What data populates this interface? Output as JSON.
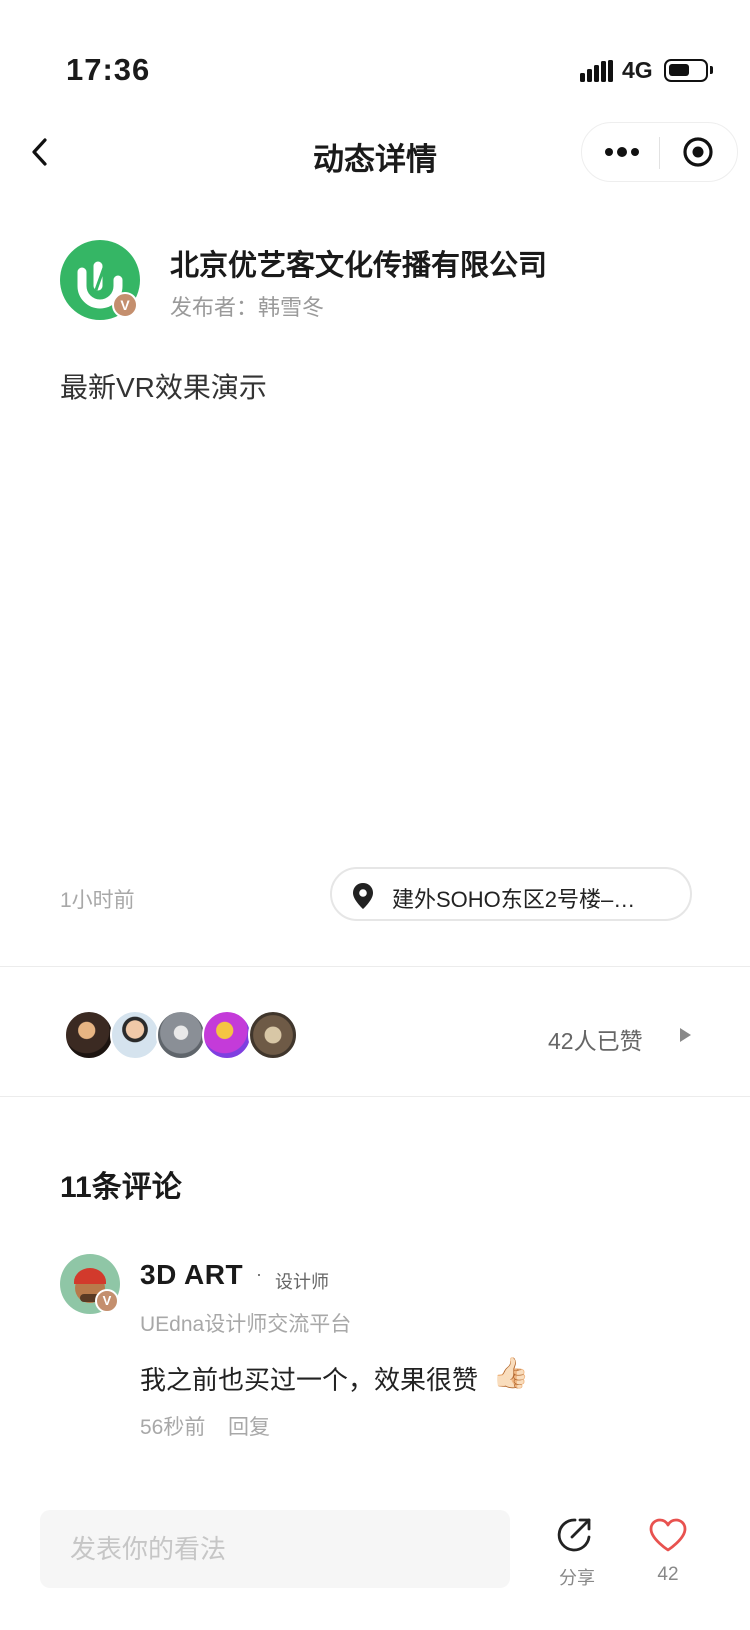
{
  "status_bar": {
    "time": "17:36",
    "network": "4G"
  },
  "nav": {
    "title": "动态详情"
  },
  "post": {
    "company": "北京优艺客文化传播有限公司",
    "publisher": "发布者：韩雪冬",
    "verified_badge": "V",
    "text": "最新VR效果演示",
    "time": "1小时前",
    "location": "建外SOHO东区2号楼–…"
  },
  "likes": {
    "count_text": "42人已赞"
  },
  "comments": {
    "title": "11条评论",
    "items": [
      {
        "name": "3D ART",
        "dot": "·",
        "role": "设计师",
        "org": "UEdna设计师交流平台",
        "text": "我之前也买过一个，效果很赞",
        "emoji": "👍🏻",
        "time": "56秒前",
        "reply": "回复",
        "verified_badge": "V"
      }
    ]
  },
  "bottom_bar": {
    "input_placeholder": "发表你的看法",
    "share_label": "分享",
    "like_count": "42"
  },
  "colors": {
    "brand_green": "#35b665",
    "like_red": "#e8524f",
    "badge_bronze": "#c48f6e"
  }
}
